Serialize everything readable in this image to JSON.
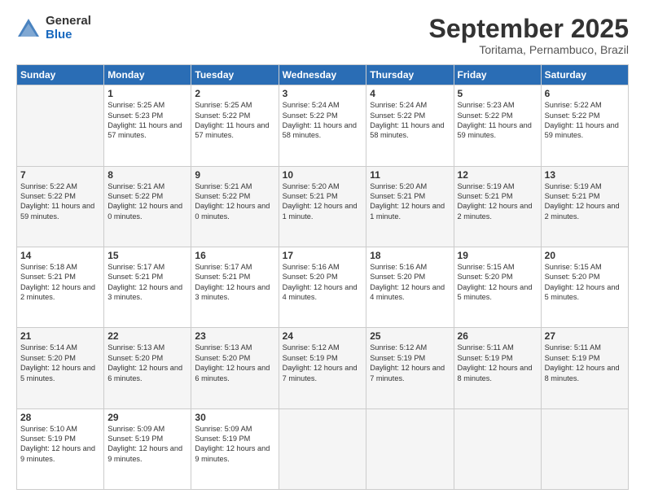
{
  "logo": {
    "general": "General",
    "blue": "Blue"
  },
  "header": {
    "month": "September 2025",
    "location": "Toritama, Pernambuco, Brazil"
  },
  "weekdays": [
    "Sunday",
    "Monday",
    "Tuesday",
    "Wednesday",
    "Thursday",
    "Friday",
    "Saturday"
  ],
  "weeks": [
    [
      {
        "day": "",
        "info": ""
      },
      {
        "day": "1",
        "info": "Sunrise: 5:25 AM\nSunset: 5:23 PM\nDaylight: 11 hours\nand 57 minutes."
      },
      {
        "day": "2",
        "info": "Sunrise: 5:25 AM\nSunset: 5:22 PM\nDaylight: 11 hours\nand 57 minutes."
      },
      {
        "day": "3",
        "info": "Sunrise: 5:24 AM\nSunset: 5:22 PM\nDaylight: 11 hours\nand 58 minutes."
      },
      {
        "day": "4",
        "info": "Sunrise: 5:24 AM\nSunset: 5:22 PM\nDaylight: 11 hours\nand 58 minutes."
      },
      {
        "day": "5",
        "info": "Sunrise: 5:23 AM\nSunset: 5:22 PM\nDaylight: 11 hours\nand 59 minutes."
      },
      {
        "day": "6",
        "info": "Sunrise: 5:22 AM\nSunset: 5:22 PM\nDaylight: 11 hours\nand 59 minutes."
      }
    ],
    [
      {
        "day": "7",
        "info": "Sunrise: 5:22 AM\nSunset: 5:22 PM\nDaylight: 11 hours\nand 59 minutes."
      },
      {
        "day": "8",
        "info": "Sunrise: 5:21 AM\nSunset: 5:22 PM\nDaylight: 12 hours\nand 0 minutes."
      },
      {
        "day": "9",
        "info": "Sunrise: 5:21 AM\nSunset: 5:22 PM\nDaylight: 12 hours\nand 0 minutes."
      },
      {
        "day": "10",
        "info": "Sunrise: 5:20 AM\nSunset: 5:21 PM\nDaylight: 12 hours\nand 1 minute."
      },
      {
        "day": "11",
        "info": "Sunrise: 5:20 AM\nSunset: 5:21 PM\nDaylight: 12 hours\nand 1 minute."
      },
      {
        "day": "12",
        "info": "Sunrise: 5:19 AM\nSunset: 5:21 PM\nDaylight: 12 hours\nand 2 minutes."
      },
      {
        "day": "13",
        "info": "Sunrise: 5:19 AM\nSunset: 5:21 PM\nDaylight: 12 hours\nand 2 minutes."
      }
    ],
    [
      {
        "day": "14",
        "info": "Sunrise: 5:18 AM\nSunset: 5:21 PM\nDaylight: 12 hours\nand 2 minutes."
      },
      {
        "day": "15",
        "info": "Sunrise: 5:17 AM\nSunset: 5:21 PM\nDaylight: 12 hours\nand 3 minutes."
      },
      {
        "day": "16",
        "info": "Sunrise: 5:17 AM\nSunset: 5:21 PM\nDaylight: 12 hours\nand 3 minutes."
      },
      {
        "day": "17",
        "info": "Sunrise: 5:16 AM\nSunset: 5:20 PM\nDaylight: 12 hours\nand 4 minutes."
      },
      {
        "day": "18",
        "info": "Sunrise: 5:16 AM\nSunset: 5:20 PM\nDaylight: 12 hours\nand 4 minutes."
      },
      {
        "day": "19",
        "info": "Sunrise: 5:15 AM\nSunset: 5:20 PM\nDaylight: 12 hours\nand 5 minutes."
      },
      {
        "day": "20",
        "info": "Sunrise: 5:15 AM\nSunset: 5:20 PM\nDaylight: 12 hours\nand 5 minutes."
      }
    ],
    [
      {
        "day": "21",
        "info": "Sunrise: 5:14 AM\nSunset: 5:20 PM\nDaylight: 12 hours\nand 5 minutes."
      },
      {
        "day": "22",
        "info": "Sunrise: 5:13 AM\nSunset: 5:20 PM\nDaylight: 12 hours\nand 6 minutes."
      },
      {
        "day": "23",
        "info": "Sunrise: 5:13 AM\nSunset: 5:20 PM\nDaylight: 12 hours\nand 6 minutes."
      },
      {
        "day": "24",
        "info": "Sunrise: 5:12 AM\nSunset: 5:19 PM\nDaylight: 12 hours\nand 7 minutes."
      },
      {
        "day": "25",
        "info": "Sunrise: 5:12 AM\nSunset: 5:19 PM\nDaylight: 12 hours\nand 7 minutes."
      },
      {
        "day": "26",
        "info": "Sunrise: 5:11 AM\nSunset: 5:19 PM\nDaylight: 12 hours\nand 8 minutes."
      },
      {
        "day": "27",
        "info": "Sunrise: 5:11 AM\nSunset: 5:19 PM\nDaylight: 12 hours\nand 8 minutes."
      }
    ],
    [
      {
        "day": "28",
        "info": "Sunrise: 5:10 AM\nSunset: 5:19 PM\nDaylight: 12 hours\nand 9 minutes."
      },
      {
        "day": "29",
        "info": "Sunrise: 5:09 AM\nSunset: 5:19 PM\nDaylight: 12 hours\nand 9 minutes."
      },
      {
        "day": "30",
        "info": "Sunrise: 5:09 AM\nSunset: 5:19 PM\nDaylight: 12 hours\nand 9 minutes."
      },
      {
        "day": "",
        "info": ""
      },
      {
        "day": "",
        "info": ""
      },
      {
        "day": "",
        "info": ""
      },
      {
        "day": "",
        "info": ""
      }
    ]
  ]
}
